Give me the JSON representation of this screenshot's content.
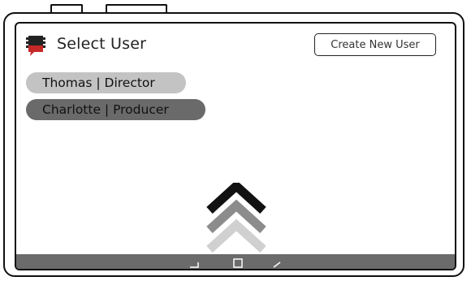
{
  "header": {
    "title": "Select User",
    "create_button_label": "Create New User",
    "app_icon": "clapperboard-icon"
  },
  "users": [
    {
      "label": "Thomas | Director",
      "style": "light"
    },
    {
      "label": "Charlotte | Producer",
      "style": "dark"
    }
  ],
  "swipe_hint": {
    "icon": "triple-chevron-up-icon"
  },
  "navbar": {
    "back_icon": "back-icon",
    "home_icon": "home-icon",
    "recent_icon": "recent-apps-icon"
  },
  "colors": {
    "accent": "#c62828",
    "pill_light": "#c3c3c3",
    "pill_dark": "#6a6a6a",
    "navbar": "#6b6b6b"
  }
}
